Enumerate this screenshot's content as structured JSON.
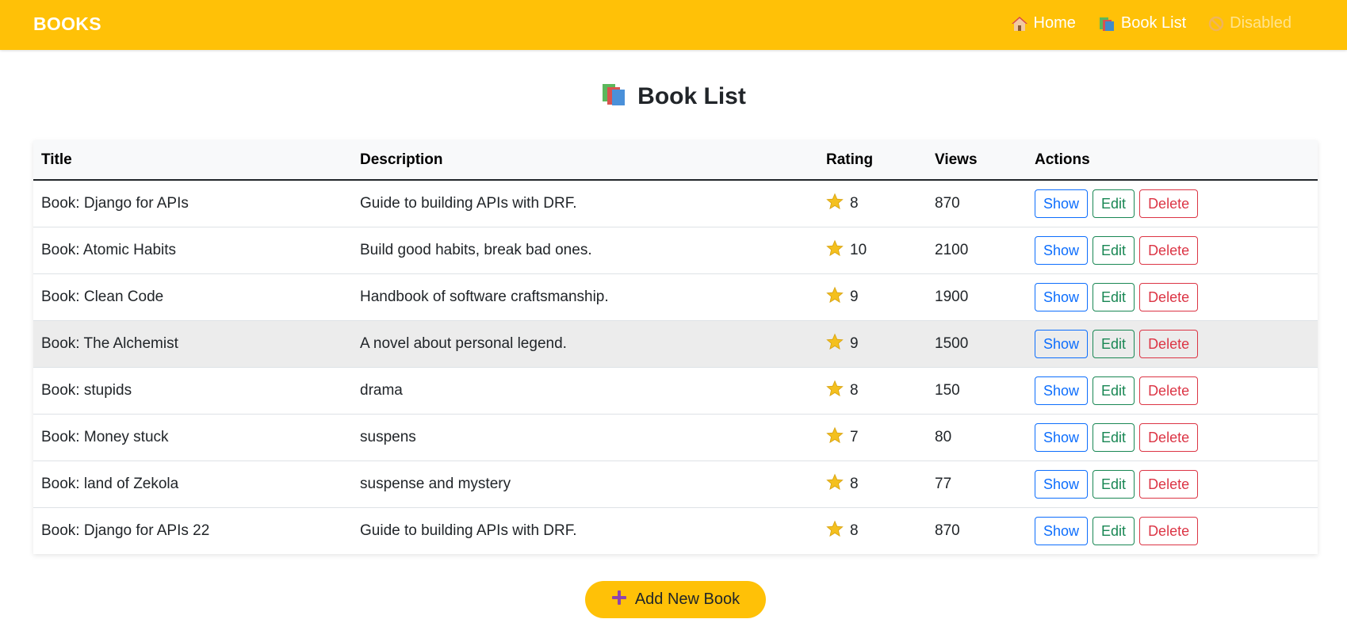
{
  "navbar": {
    "brand": "BOOKS",
    "links": [
      {
        "label": "Home",
        "icon": "house-icon"
      },
      {
        "label": "Book List",
        "icon": "books-icon"
      },
      {
        "label": "Disabled",
        "icon": "prohibited-icon",
        "disabled": true
      }
    ]
  },
  "page": {
    "title": "Book List",
    "title_icon": "books-icon"
  },
  "table": {
    "headers": [
      "Title",
      "Description",
      "Rating",
      "Views",
      "Actions"
    ],
    "rows": [
      {
        "title": "Book: Django for APIs",
        "description": "Guide to building APIs with DRF.",
        "rating": "8",
        "views": "870"
      },
      {
        "title": "Book: Atomic Habits",
        "description": "Build good habits, break bad ones.",
        "rating": "10",
        "views": "2100"
      },
      {
        "title": "Book: Clean Code",
        "description": "Handbook of software craftsmanship.",
        "rating": "9",
        "views": "1900"
      },
      {
        "title": "Book: The Alchemist",
        "description": "A novel about personal legend.",
        "rating": "9",
        "views": "1500"
      },
      {
        "title": "Book: stupids",
        "description": "drama",
        "rating": "8",
        "views": "150"
      },
      {
        "title": "Book: Money stuck",
        "description": "suspens",
        "rating": "7",
        "views": "80"
      },
      {
        "title": "Book: land of Zekola",
        "description": "suspense and mystery",
        "rating": "8",
        "views": "77"
      },
      {
        "title": "Book: Django for APIs 22",
        "description": "Guide to building APIs with DRF.",
        "rating": "8",
        "views": "870"
      }
    ],
    "actions": {
      "show": "Show",
      "edit": "Edit",
      "delete": "Delete"
    },
    "hovered_row_index": 3
  },
  "add_button": {
    "label": "Add New Book",
    "icon": "plus-icon"
  },
  "colors": {
    "navbar": "#ffc107",
    "show": "#0d6efd",
    "edit": "#198754",
    "delete": "#dc3545",
    "star": "#f4c01e",
    "plus": "#8e44ad"
  }
}
